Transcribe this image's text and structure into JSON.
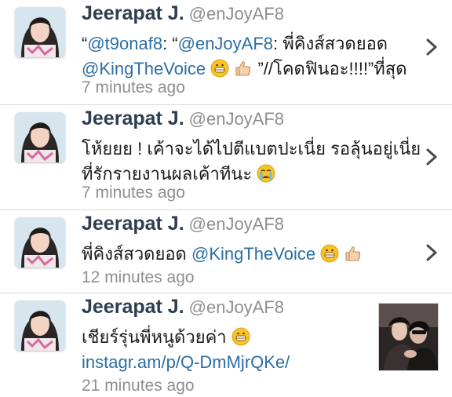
{
  "tweets": [
    {
      "name": "Jeerapat J.",
      "handle": "@enJoyAF8",
      "line1": {
        "open": "“",
        "mention1": "@t9onaf8",
        "mid1": ": “",
        "mention2": "@enJoyAF8",
        "mid2": ": พี่คิงส์สวดยอด"
      },
      "line2": {
        "mention": "@KingTheVoice",
        "tail": "”//โคดฟินอะ!!!!”ที่สุด"
      },
      "time": "7 minutes ago"
    },
    {
      "name": "Jeerapat J.",
      "handle": "@enJoyAF8",
      "line1": "โห้ยยย ! เค้าจะได้ไปตีแบตปะเนี่ย รอลุ้นอยู่เนี่ย",
      "line2": "ที่รักรายงานผลเค้าทีนะ",
      "time": "7 minutes ago"
    },
    {
      "name": "Jeerapat J.",
      "handle": "@enJoyAF8",
      "line1": {
        "text": "พี่คิงส์สวดยอด",
        "mention": "@KingTheVoice"
      },
      "time": "12 minutes ago"
    },
    {
      "name": "Jeerapat J.",
      "handle": "@enJoyAF8",
      "line1": "เชียร์รุ่นพี่หนูด้วยค่า",
      "link": "instagr.am/p/Q-DmMjrQKe/",
      "time": "21 minutes ago"
    }
  ],
  "icons": {
    "chevron": "chevron-right-icon",
    "grin": "grinning-face-emoji",
    "thumb": "thumbs-up-emoji",
    "cry": "crying-face-emoji"
  },
  "colors": {
    "name": "#2d3e50",
    "handle": "#8e8e93",
    "mention": "#2b6ea6",
    "divider": "#d9d9d9",
    "emoji": "#f7c325"
  }
}
